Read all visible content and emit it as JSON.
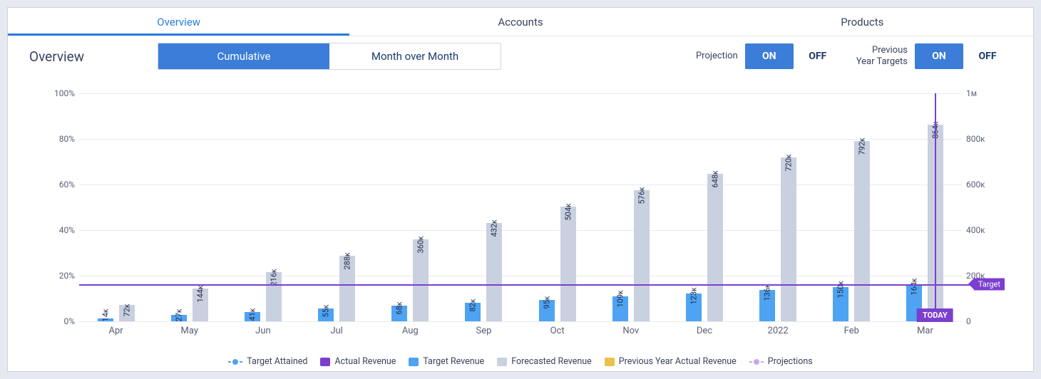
{
  "tabs": {
    "overview": "Overview",
    "accounts": "Accounts",
    "products": "Products"
  },
  "page": {
    "title": "Overview"
  },
  "segmented": {
    "cumulative": "Cumulative",
    "mom": "Month over Month"
  },
  "toggles": {
    "projection_label": "Projection",
    "prev_year_label_line1": "Previous",
    "prev_year_label_line2": "Year Targets",
    "on": "ON",
    "off": "OFF"
  },
  "axes": {
    "left_ticks": [
      "0%",
      "20%",
      "40%",
      "60%",
      "80%",
      "100%"
    ],
    "right_ticks": [
      "0",
      "200ᴋ",
      "400ᴋ",
      "600ᴋ",
      "800ᴋ",
      "1ᴍ"
    ]
  },
  "legend": {
    "target_attained": "Target Attained",
    "actual_revenue": "Actual Revenue",
    "target_revenue": "Target Revenue",
    "forecasted_revenue": "Forecasted Revenue",
    "prev_year_actual": "Previous Year Actual Revenue",
    "projections": "Projections"
  },
  "markers": {
    "target": "Target",
    "today": "TODAY"
  },
  "chart_data": {
    "type": "bar",
    "categories": [
      "Apr",
      "May",
      "Jun",
      "Jul",
      "Aug",
      "Sep",
      "Oct",
      "Nov",
      "Dec",
      "2022",
      "Feb",
      "Mar"
    ],
    "series": [
      {
        "name": "Target Revenue",
        "color": "#4ea3f2",
        "labels": [
          "14ᴋ",
          "27ᴋ",
          "41ᴋ",
          "55ᴋ",
          "68ᴋ",
          "82ᴋ",
          "95ᴋ",
          "109ᴋ",
          "123ᴋ",
          "136ᴋ",
          "150ᴋ",
          "164ᴋ"
        ],
        "values": [
          14000,
          27000,
          41000,
          55000,
          68000,
          82000,
          95000,
          109000,
          123000,
          136000,
          150000,
          164000
        ]
      },
      {
        "name": "Forecasted Revenue",
        "color": "#c9d0e0",
        "labels": [
          "72ᴋ",
          "144ᴋ",
          "216ᴋ",
          "288ᴋ",
          "360ᴋ",
          "432ᴋ",
          "504ᴋ",
          "576ᴋ",
          "648ᴋ",
          "720ᴋ",
          "792ᴋ",
          "864ᴋ"
        ],
        "values": [
          72000,
          144000,
          216000,
          288000,
          360000,
          432000,
          504000,
          576000,
          648000,
          720000,
          792000,
          864000
        ]
      }
    ],
    "right_axis_max": 1000000,
    "left_axis_max_pct": 100,
    "target_line_value": 164000,
    "today_category": "Mar"
  }
}
